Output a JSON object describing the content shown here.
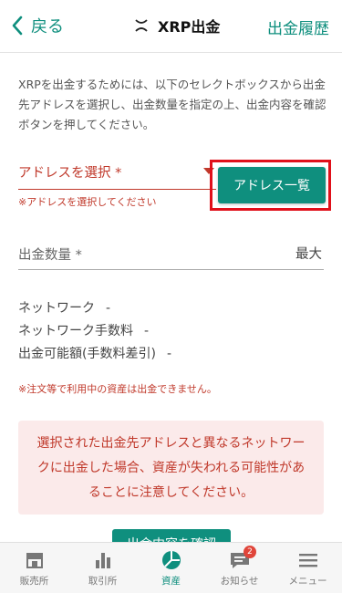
{
  "header": {
    "back_label": "戻る",
    "title": "XRP出金",
    "history_label": "出金履歴"
  },
  "intro_text": "XRPを出金するためには、以下のセレクトボックスから出金先アドレスを選択し、出金数量を指定の上、出金内容を確認ボタンを押してください。",
  "address": {
    "placeholder": "アドレスを選択 *",
    "error": "※アドレスを選択してください",
    "list_button_label": "アドレス一覧"
  },
  "quantity": {
    "label": "出金数量 *",
    "max_label": "最大"
  },
  "info": [
    {
      "label": "ネットワーク",
      "value": "-"
    },
    {
      "label": "ネットワーク手数料",
      "value": "-"
    },
    {
      "label": "出金可能額(手数料差引)",
      "value": "-"
    }
  ],
  "notice": "※注文等で利用中の資産は出金できません。",
  "warning": "選択された出金先アドレスと異なるネットワークに出金した場合、資産が失われる可能性があることに注意してください。",
  "confirm_button_label": "出金内容を確認",
  "tabs": [
    {
      "label": "販売所",
      "icon": "shop-icon"
    },
    {
      "label": "取引所",
      "icon": "chart-bars-icon"
    },
    {
      "label": "資産",
      "icon": "pie-chart-icon"
    },
    {
      "label": "お知らせ",
      "icon": "message-icon",
      "badge": "2"
    },
    {
      "label": "メニュー",
      "icon": "menu-icon"
    }
  ],
  "colors": {
    "accent": "#0f8f7e",
    "error": "#c0392b",
    "highlight": "#e0101a"
  }
}
